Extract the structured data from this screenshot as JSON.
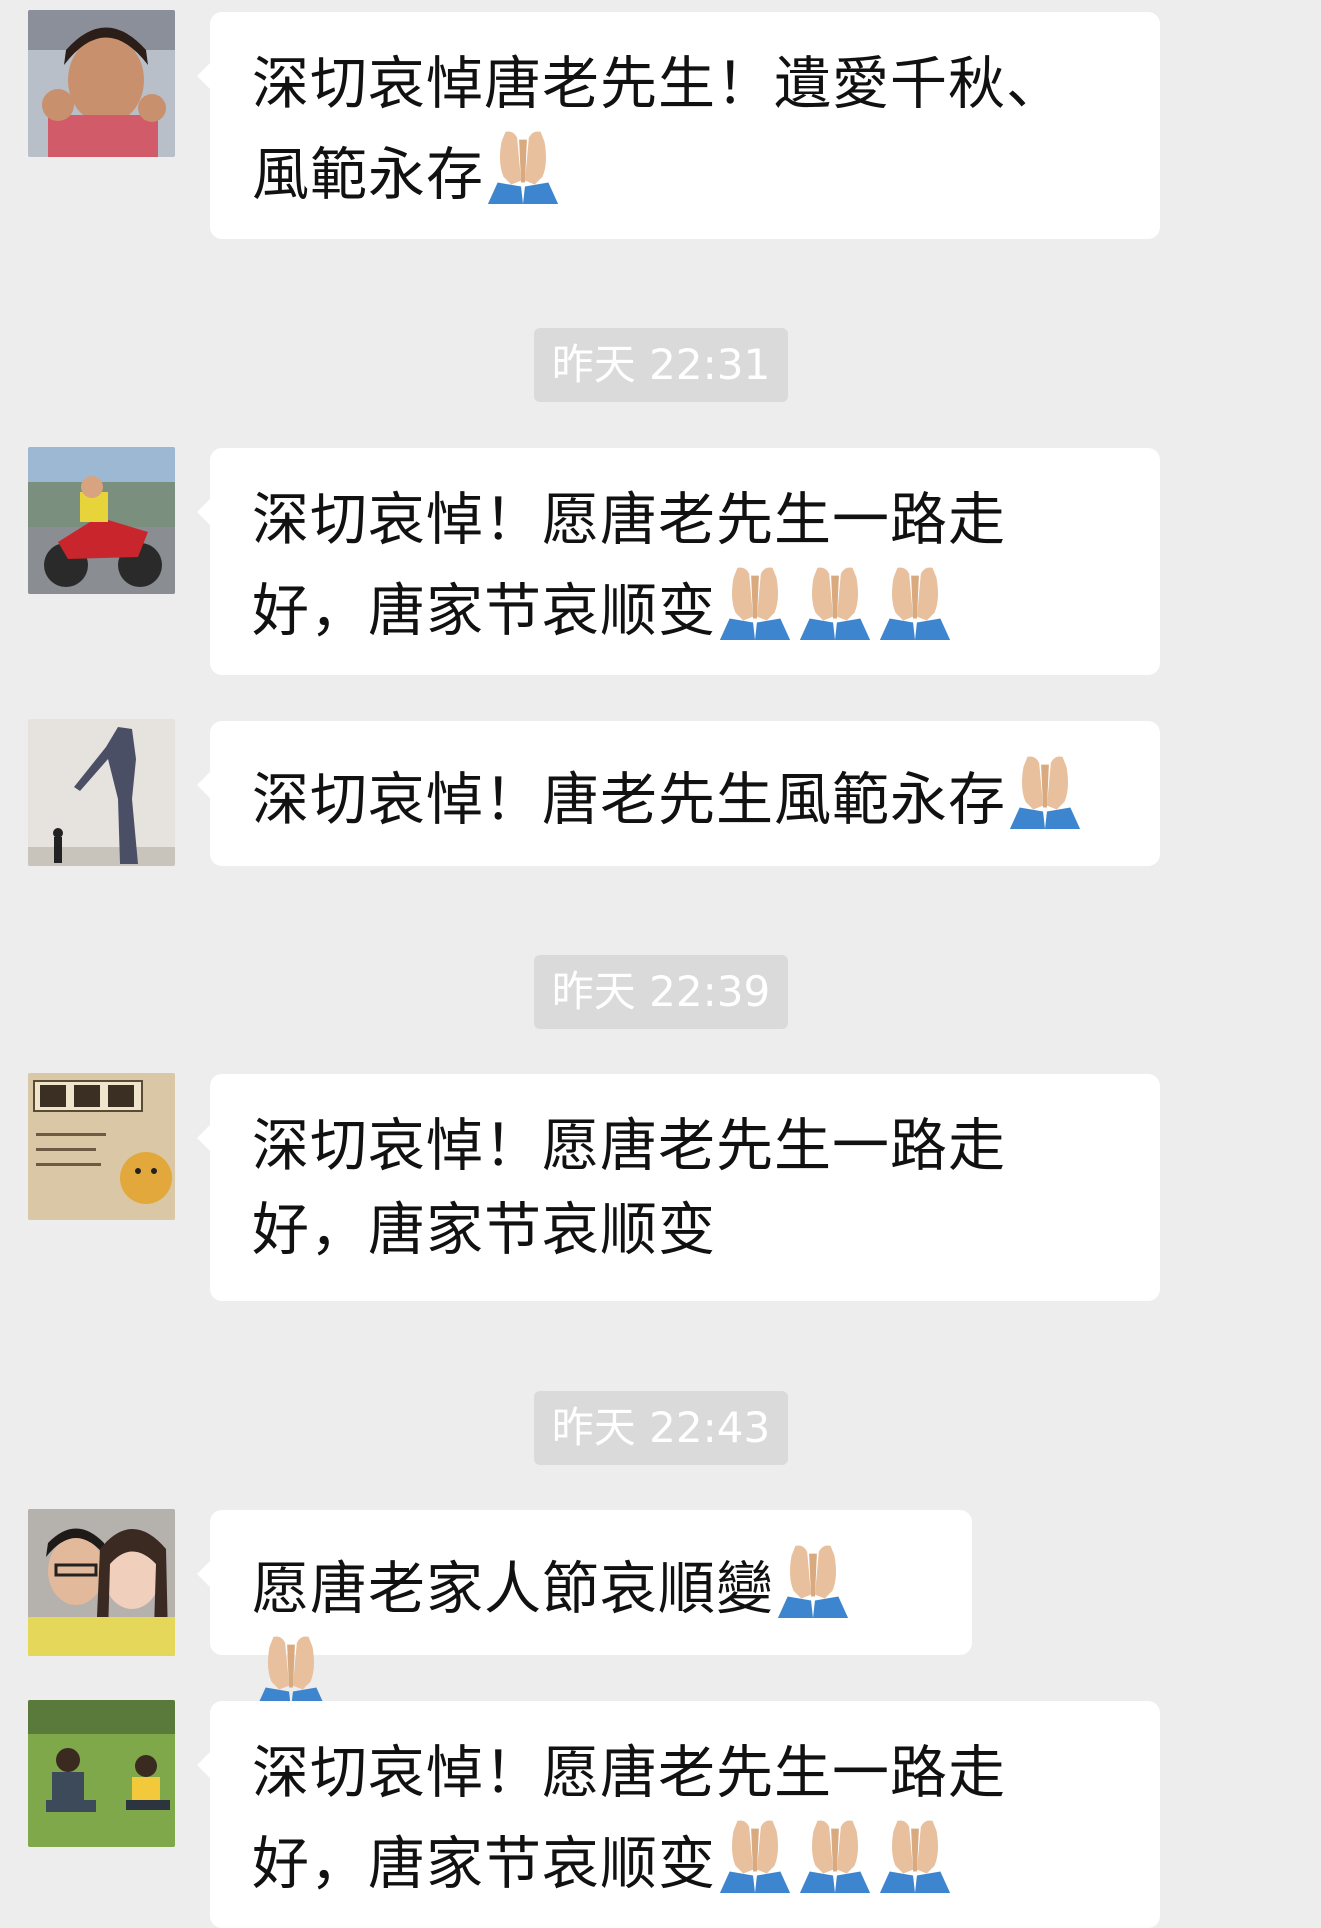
{
  "messages": [
    {
      "text": "深切哀悼唐老先生！遺愛千秋、風範永存",
      "pray_count": 1
    },
    {
      "text": "深切哀悼！愿唐老先生一路走好，唐家节哀顺变",
      "pray_count": 3
    },
    {
      "text": "深切哀悼！唐老先生風範永存",
      "pray_count": 1
    },
    {
      "text": "深切哀悼！愿唐老先生一路走好，唐家节哀顺变",
      "pray_count": 0
    },
    {
      "text": "愿唐老家人節哀順變",
      "pray_count": 2
    },
    {
      "text": "深切哀悼！愿唐老先生一路走好，唐家节哀顺变",
      "pray_count": 3
    }
  ],
  "timestamps": [
    "昨天 22:31",
    "昨天 22:39",
    "昨天 22:43"
  ],
  "colors": {
    "background": "#ededed",
    "bubble": "#ffffff",
    "timestamp_bg": "#dadada",
    "timestamp_text": "#ffffff",
    "text": "#111111"
  },
  "icons": {
    "reaction": "folded-hands-icon"
  }
}
